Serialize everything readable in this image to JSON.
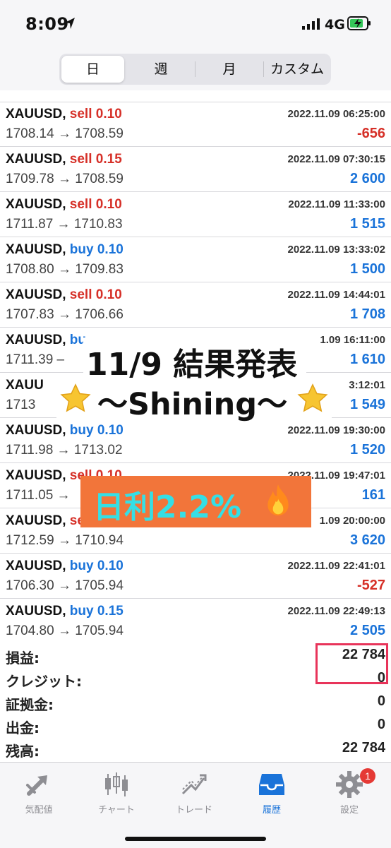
{
  "status_bar": {
    "time": "8:09",
    "network": "4G"
  },
  "tabs": [
    "日",
    "週",
    "月",
    "カスタム"
  ],
  "trades": [
    {
      "symbol": "XAUUSD,",
      "side": "sell",
      "volume": "0.10",
      "datetime": "2022.11.09 06:25:00",
      "prices": "1708.14 → 1708.59",
      "profit": "-656",
      "profit_sign": "neg"
    },
    {
      "symbol": "XAUUSD,",
      "side": "sell",
      "volume": "0.15",
      "datetime": "2022.11.09 07:30:15",
      "prices": "1709.78 → 1708.59",
      "profit": "2 600",
      "profit_sign": "pos"
    },
    {
      "symbol": "XAUUSD,",
      "side": "sell",
      "volume": "0.10",
      "datetime": "2022.11.09 11:33:00",
      "prices": "1711.87 → 1710.83",
      "profit": "1 515",
      "profit_sign": "pos"
    },
    {
      "symbol": "XAUUSD,",
      "side": "buy",
      "volume": "0.10",
      "datetime": "2022.11.09 13:33:02",
      "prices": "1708.80 → 1709.83",
      "profit": "1 500",
      "profit_sign": "pos"
    },
    {
      "symbol": "XAUUSD,",
      "side": "sell",
      "volume": "0.10",
      "datetime": "2022.11.09 14:44:01",
      "prices": "1707.83 → 1706.66",
      "profit": "1 708",
      "profit_sign": "pos"
    },
    {
      "symbol": "XAUUSD,",
      "side": "bu",
      "volume": "",
      "datetime": "1.09 16:11:00",
      "prices": "1711.39 –",
      "profit": "1 610",
      "profit_sign": "pos"
    },
    {
      "symbol": "XAUU",
      "side": "",
      "volume": "",
      "datetime": "3:12:01",
      "prices": "1713",
      "profit": "1 549",
      "profit_sign": "pos"
    },
    {
      "symbol": "XAUUSD,",
      "side": "buy",
      "volume": "0.10",
      "datetime": "2022.11.09 19:30:00",
      "prices": "1711.98 → 1713.02",
      "profit": "1 520",
      "profit_sign": "pos"
    },
    {
      "symbol": "XAUUSD,",
      "side": "sell",
      "volume": "0.10",
      "datetime": "2022.11.09 19:47:01",
      "prices": "1711.05 →",
      "profit": "161",
      "profit_sign": "pos"
    },
    {
      "symbol": "XAUUSD,",
      "side": "se",
      "volume": "",
      "datetime": "1.09 20:00:00",
      "prices": "1712.59 → 1710.94",
      "profit": "3 620",
      "profit_sign": "pos"
    },
    {
      "symbol": "XAUUSD,",
      "side": "buy",
      "volume": "0.10",
      "datetime": "2022.11.09 22:41:01",
      "prices": "1706.30 → 1705.94",
      "profit": "-527",
      "profit_sign": "neg"
    },
    {
      "symbol": "XAUUSD,",
      "side": "buy",
      "volume": "0.15",
      "datetime": "2022.11.09 22:49:13",
      "prices": "1704.80 → 1705.94",
      "profit": "2 505",
      "profit_sign": "pos"
    }
  ],
  "summary": [
    {
      "label": "損益:",
      "value": "22 784"
    },
    {
      "label": "クレジット:",
      "value": "0"
    },
    {
      "label": "証拠金:",
      "value": "0"
    },
    {
      "label": "出金:",
      "value": "0"
    },
    {
      "label": "残高:",
      "value": "22 784"
    }
  ],
  "bottom_tabs": [
    {
      "label": "気配値",
      "icon": "quotes-arrows-icon"
    },
    {
      "label": "チャート",
      "icon": "chart-candles-icon"
    },
    {
      "label": "トレード",
      "icon": "trade-trend-icon"
    },
    {
      "label": "履歴",
      "icon": "history-inbox-icon",
      "active": true
    },
    {
      "label": "設定",
      "icon": "settings-gear-icon",
      "badge": "1"
    }
  ],
  "overlay": {
    "title": "11/9 結果発表",
    "subtitle": "〜Shining〜",
    "badge": "日利2.2%"
  },
  "colors": {
    "sell": "#d63028",
    "buy": "#1a73d9",
    "accent_badge": "#f2753a",
    "badge_text": "#35dfe5",
    "highlight": "#e8345a"
  }
}
